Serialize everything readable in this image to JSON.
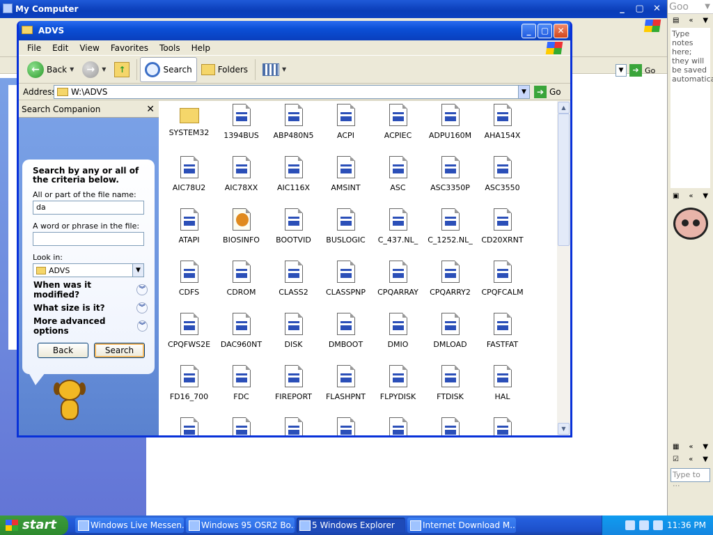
{
  "bg_window": {
    "title": "My Computer",
    "address_go": "Go"
  },
  "right_sidebar": {
    "note_text": "Type notes here; they will be saved automatically.",
    "bottom_input_placeholder": "Type to ..."
  },
  "window": {
    "title": "ADVS",
    "menu": [
      "File",
      "Edit",
      "View",
      "Favorites",
      "Tools",
      "Help"
    ],
    "toolbar": {
      "back": "Back",
      "search": "Search",
      "folders": "Folders"
    },
    "address": {
      "label": "Address",
      "value": "W:\\ADVS",
      "go": "Go"
    }
  },
  "companion": {
    "header": "Search Companion",
    "heading": "Search by any or all of the criteria below.",
    "filename_label": "All or part of the file name:",
    "filename_value": "da",
    "phrase_label": "A word or phrase in the file:",
    "phrase_value": "",
    "look_label": "Look in:",
    "look_value": "ADVS",
    "options": [
      "When was it modified?",
      "What size is it?",
      "More advanced options"
    ],
    "back_button": "Back",
    "search_button": "Search"
  },
  "files": [
    {
      "name": "SYSTEM32",
      "type": "folder"
    },
    {
      "name": "1394BUS",
      "type": "driver"
    },
    {
      "name": "ABP480N5",
      "type": "driver"
    },
    {
      "name": "ACPI",
      "type": "driver"
    },
    {
      "name": "ACPIEC",
      "type": "driver"
    },
    {
      "name": "ADPU160M",
      "type": "driver"
    },
    {
      "name": "AHA154X",
      "type": "driver"
    },
    {
      "name": "AIC78U2",
      "type": "driver"
    },
    {
      "name": "AIC78XX",
      "type": "driver"
    },
    {
      "name": "AIC116X",
      "type": "driver"
    },
    {
      "name": "AMSINT",
      "type": "driver"
    },
    {
      "name": "ASC",
      "type": "driver"
    },
    {
      "name": "ASC3350P",
      "type": "driver"
    },
    {
      "name": "ASC3550",
      "type": "driver"
    },
    {
      "name": "ATAPI",
      "type": "driver"
    },
    {
      "name": "BIOSINFO",
      "type": "settings"
    },
    {
      "name": "BOOTVID",
      "type": "driver"
    },
    {
      "name": "BUSLOGIC",
      "type": "driver"
    },
    {
      "name": "C_437.NL_",
      "type": "driver"
    },
    {
      "name": "C_1252.NL_",
      "type": "driver"
    },
    {
      "name": "CD20XRNT",
      "type": "driver"
    },
    {
      "name": "CDFS",
      "type": "driver"
    },
    {
      "name": "CDROM",
      "type": "driver"
    },
    {
      "name": "CLASS2",
      "type": "driver"
    },
    {
      "name": "CLASSPNP",
      "type": "driver"
    },
    {
      "name": "CPQARRAY",
      "type": "driver"
    },
    {
      "name": "CPQARRY2",
      "type": "driver"
    },
    {
      "name": "CPQFCALM",
      "type": "driver"
    },
    {
      "name": "CPQFWS2E",
      "type": "driver"
    },
    {
      "name": "DAC960NT",
      "type": "driver"
    },
    {
      "name": "DISK",
      "type": "driver"
    },
    {
      "name": "DMBOOT",
      "type": "driver"
    },
    {
      "name": "DMIO",
      "type": "driver"
    },
    {
      "name": "DMLOAD",
      "type": "driver"
    },
    {
      "name": "FASTFAT",
      "type": "driver"
    },
    {
      "name": "FD16_700",
      "type": "driver"
    },
    {
      "name": "FDC",
      "type": "driver"
    },
    {
      "name": "FIREPORT",
      "type": "driver"
    },
    {
      "name": "FLASHPNT",
      "type": "driver"
    },
    {
      "name": "FLPYDISK",
      "type": "driver"
    },
    {
      "name": "FTDISK",
      "type": "driver"
    },
    {
      "name": "HAL",
      "type": "driver"
    },
    {
      "name": "",
      "type": "driver"
    },
    {
      "name": "",
      "type": "driver"
    },
    {
      "name": "",
      "type": "driver"
    },
    {
      "name": "",
      "type": "driver"
    },
    {
      "name": "",
      "type": "driver"
    },
    {
      "name": "",
      "type": "driver"
    },
    {
      "name": "",
      "type": "driver"
    }
  ],
  "taskbar": {
    "start": "start",
    "tasks": [
      "Windows Live Messen...",
      "Windows 95 OSR2 Bo...",
      "5 Windows Explorer",
      "Internet Download M..."
    ],
    "clock": "11:36 PM"
  }
}
